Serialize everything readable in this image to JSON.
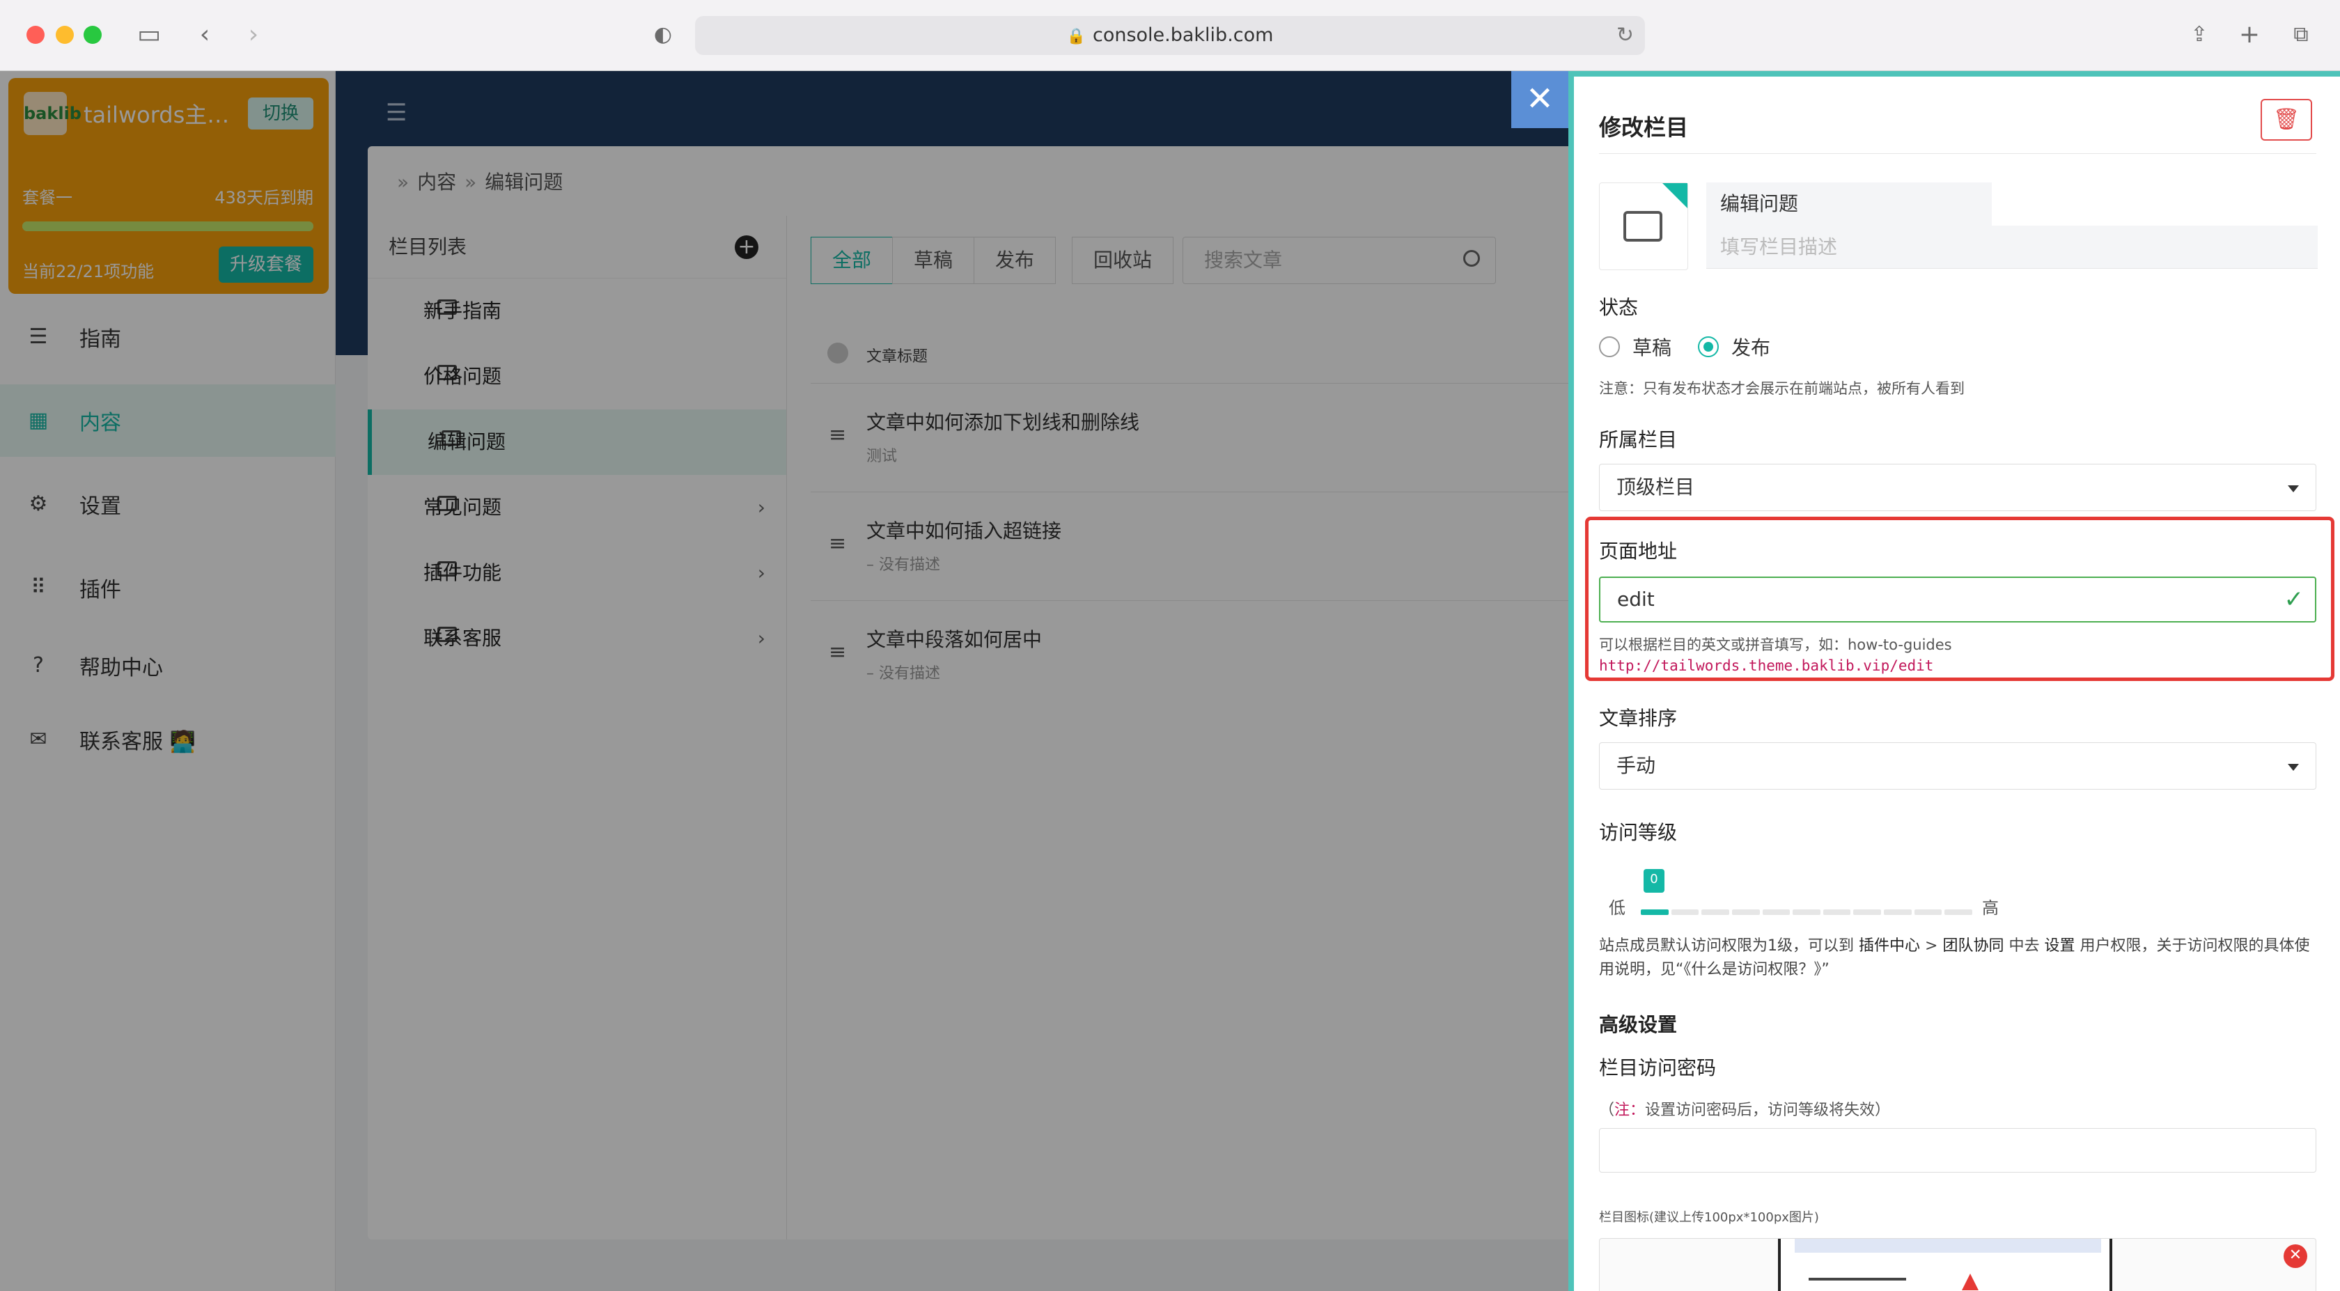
{
  "browser": {
    "url": "console.baklib.com"
  },
  "sidebar": {
    "site_name": "tailwords主题...",
    "switch_label": "切换",
    "plan_name": "套餐一",
    "plan_expire": "438天后到期",
    "plan_usage": "当前22/21项功能",
    "plan_usage_progress": 1.0,
    "upgrade_label": "升级套餐",
    "logo_text": "baklib",
    "items": [
      {
        "label": "指南",
        "icon": "sliders-icon"
      },
      {
        "label": "内容",
        "icon": "grid-icon"
      },
      {
        "label": "设置",
        "icon": "gear-icon"
      },
      {
        "label": "插件",
        "icon": "dots-grid-icon"
      },
      {
        "label": "帮助中心",
        "icon": "help-icon"
      },
      {
        "label": "联系客服 🧑‍💻",
        "icon": "chat-icon"
      }
    ]
  },
  "breadcrumb": {
    "root": "内容",
    "current": "编辑问题"
  },
  "columns": {
    "header": "栏目列表",
    "items": [
      {
        "label": "新手指南"
      },
      {
        "label": "价格问题"
      },
      {
        "label": "编辑问题"
      },
      {
        "label": "常见问题"
      },
      {
        "label": "插件功能"
      },
      {
        "label": "联系客服"
      }
    ]
  },
  "tabs": [
    "全部",
    "草稿",
    "发布",
    "回收站"
  ],
  "search_placeholder": "搜索文章",
  "articles": {
    "header": "文章标题",
    "rows": [
      {
        "title": "文章中如何添加下划线和删除线",
        "desc": "测试"
      },
      {
        "title": "文章中如何插入超链接",
        "desc": "– 没有描述"
      },
      {
        "title": "文章中段落如何居中",
        "desc": "– 没有描述"
      }
    ]
  },
  "drawer": {
    "title": "修改栏目",
    "name_value": "编辑问题",
    "desc_placeholder": "填写栏目描述",
    "status_label": "状态",
    "status_draft": "草稿",
    "status_publish": "发布",
    "status_note": "注意：只有发布状态才会展示在前端站点，被所有人看到",
    "parent_label": "所属栏目",
    "parent_value": "顶级栏目",
    "url_label": "页面地址",
    "url_value": "edit",
    "url_hint": "可以根据栏目的英文或拼音填写，如：how-to-guides",
    "url_full": "http://tailwords.theme.baklib.vip/edit",
    "sort_label": "文章排序",
    "sort_value": "手动",
    "access_label": "访问等级",
    "access_low": "低",
    "access_high": "高",
    "access_value": "0",
    "access_levels": 11,
    "access_help_1": "站点成员默认访问权限为1级，可以到 ",
    "access_help_plugin": "插件中心",
    "access_help_2": " > ",
    "access_help_team": "团队协同",
    "access_help_3": " 中去 ",
    "access_help_settings": "设置",
    "access_help_4": " 用户权限，关于访问权限的具体使用说明，见“《什么是访问权限？》”",
    "advanced_label": "高级设置",
    "password_label": "栏目访问密码",
    "password_note_prefix": "（",
    "password_note_emph": "注：",
    "password_note_text": "设置访问密码后，访问等级将失效）",
    "icon_label": "栏目图标(建议上传100px*100px图片)"
  }
}
